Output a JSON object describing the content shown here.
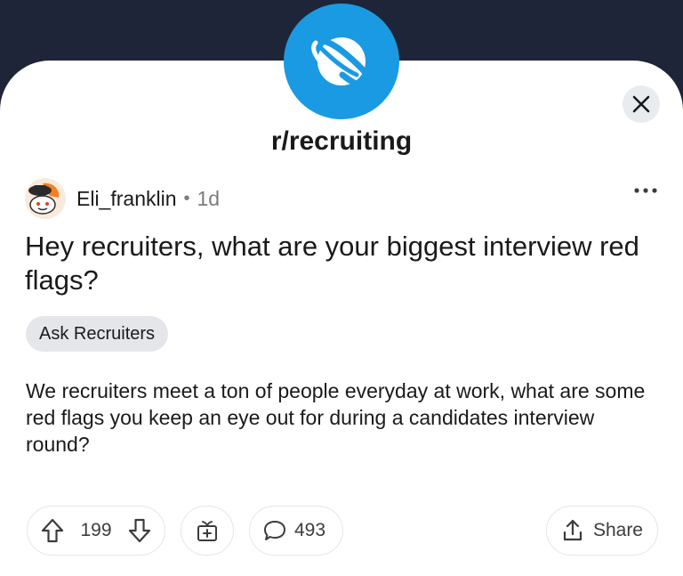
{
  "subreddit": {
    "name": "r/recruiting"
  },
  "post": {
    "author": "Eli_franklin",
    "separator": "•",
    "age": "1d",
    "title": "Hey recruiters, what are your biggest interview red flags?",
    "flair": "Ask Recruiters",
    "body": "We recruiters meet a ton of people everyday at work, what are some red flags you keep an eye out for during a candidates interview round?"
  },
  "actions": {
    "upvotes": "199",
    "comments": "493",
    "share_label": "Share"
  },
  "colors": {
    "header_bg": "#1f2538",
    "sub_icon_bg": "#1a9ae3",
    "flair_bg": "#e4e6e9"
  },
  "icons": [
    "planet-icon",
    "close-icon",
    "more-icon",
    "upvote-icon",
    "downvote-icon",
    "award-icon",
    "comment-icon",
    "share-icon"
  ]
}
